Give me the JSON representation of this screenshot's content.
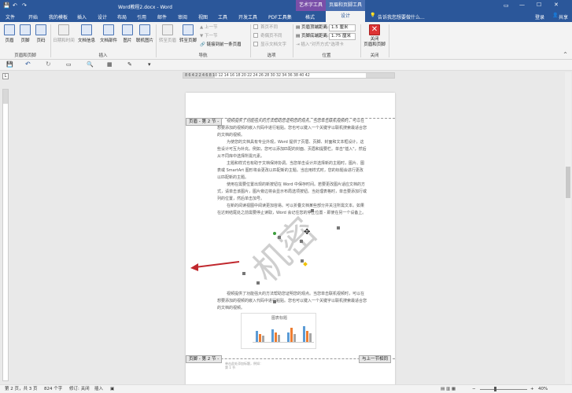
{
  "title": {
    "doc_name": "Word教程2.docx - Word",
    "ctx_art": "艺术字工具",
    "ctx_hf": "页眉和页脚工具",
    "login": "登录",
    "share": "共享"
  },
  "tabs": [
    "文件",
    "开始",
    "我的模板",
    "插入",
    "设计",
    "布局",
    "引用",
    "邮件",
    "审阅",
    "视图",
    "工具",
    "开发工具",
    "PDF工具集",
    "格式",
    "设计"
  ],
  "tellme": "告诉我您想要做什么...",
  "ribbon": {
    "header": "页眉",
    "footer": "页脚",
    "page_number": "页码",
    "group_hf": "页眉和页脚",
    "date_time": "日期和时间",
    "doc_info": "文档信息",
    "doc_parts": "文档部件",
    "picture": "图片",
    "online_picture": "联机图片",
    "group_insert": "插入",
    "goto_header": "转至页眉",
    "goto_footer": "转至页脚",
    "prev": "上一节",
    "next": "下一节",
    "link_prev": "链接到前一条页眉",
    "group_nav": "导航",
    "diff_first": "首页不同",
    "diff_odd_even": "奇偶页不同",
    "show_text": "显示文档文字",
    "group_options": "选项",
    "header_top_label": "页眉顶端距离:",
    "header_top_value": "1.5 厘米",
    "footer_bottom_label": "页脚底端距离:",
    "footer_bottom_value": "1.75 厘米",
    "insert_align_tab": "插入\"对齐方式\"选项卡",
    "group_position": "位置",
    "close_label": "关闭\n页眉和页脚",
    "group_close": "关闭"
  },
  "ruler_ticks": "8  6  4  2     2  4  6  8  10  12  14  16  18  20  22  24  26  28  30  32  34  36  38  40  42",
  "doc": {
    "header_tag": "页眉 - 第 2 节 -",
    "footer_tag": "页脚 - 第 2 节 -",
    "same_as_prev": "与上一节相同",
    "watermark": "机密",
    "paragraphs": [
      "视频提供了功能强大的方法帮助您证明您的观点。当您单击联机视频时，可以在想要添加的视频的嵌入代码中进行粘贴。您也可以键入一个关键字以联机搜索最适合您的文档的视频。",
      "为使您的文档具有专业外观，Word 提供了页眉、页脚、封面和文本框设计，这些设计可互为补充。例如，您可以添加匹配的封面、页眉和提要栏。单击\"插入\"，然后从不同库中选择所需元素。",
      "主题和样式也有助于文档保持协调。当您单击设计并选择新的主题时，图片、图表或 SmartArt 图形将会更改以匹配新的主题。当应用样式时，您的标题会进行更改以匹配新的主题。",
      "使用在需要位置出现的新按钮在 Word 中保存时间。若要更改图片适应文档的方式，请单击该图片，图片旁边将会显示布局选项按钮。当处理表格时，单击要添加行或列的位置，然后单击加号。",
      "在新的阅读视图中阅读更加容易。可以折叠文档某些部分并关注所需文本。如果在达到结尾处之前需要停止读取，Word 会记住您的停止位置 - 即使在另一个设备上。"
    ],
    "lower_paragraph": "视频提供了功能强大的方法帮助您证明您的观点。当您单击联机视频时，可以在想要添加的视频的嵌入代码中进行粘贴。您也可以键入一个关键字以联机搜索最适合您的文档的视频。",
    "chart_title": "图表标题",
    "footer_text": "单击此处添加标题，例如：",
    "footer_text2": "第 1 节"
  },
  "status": {
    "page": "第 2 页，共 3 页",
    "words": "824 个字",
    "track": "修订: 关闭",
    "mode": "插入",
    "zoom": "40%"
  },
  "colors": {
    "accent": "#2b579a",
    "ctx_art": "#7a4fa8",
    "ctx_hf": "#4a6fb0",
    "arrow": "#c0282e"
  }
}
